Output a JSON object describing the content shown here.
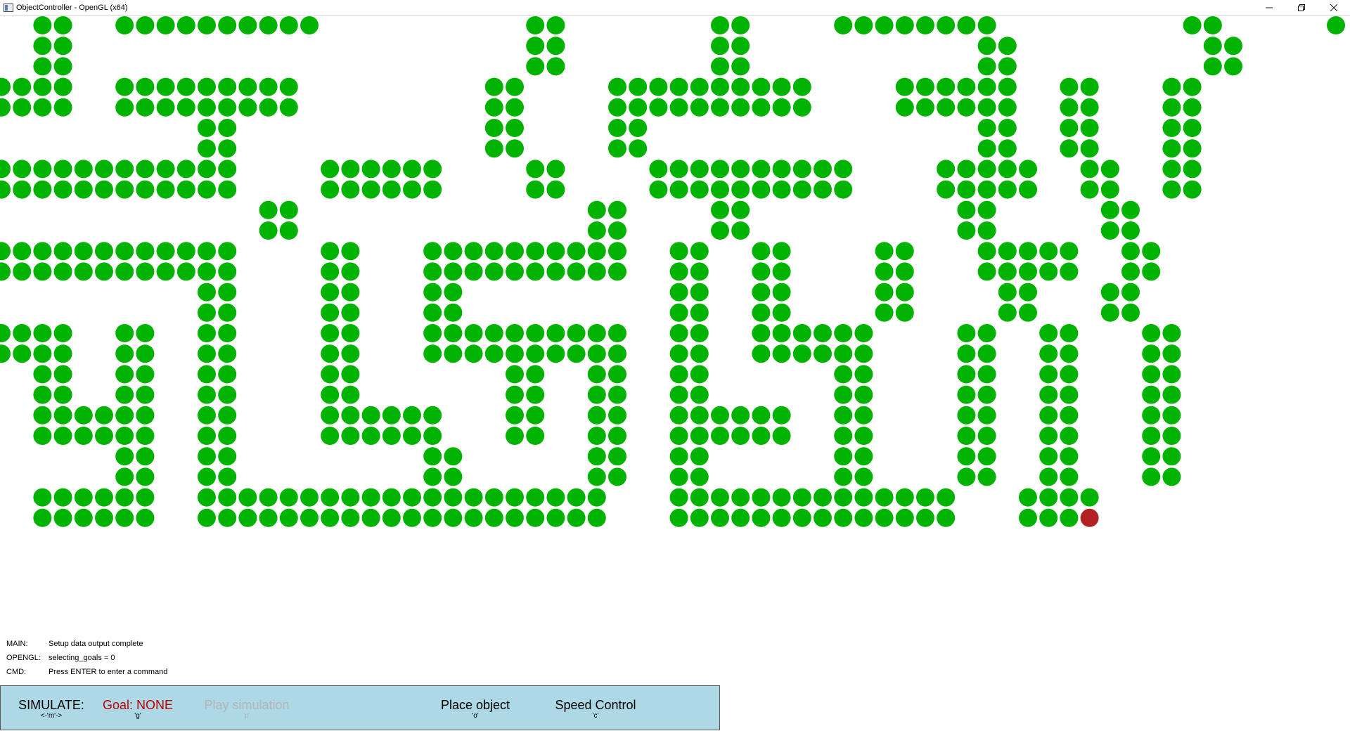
{
  "window": {
    "title": "ObjectController - OpenGL (x64)",
    "controls": [
      "minimize-icon",
      "restore-icon",
      "close-icon"
    ]
  },
  "maze": {
    "wall_color": "#00b300",
    "agent_color": "#b22222",
    "rows": [
      "..xx..xxxxxxxxxx..........xx.......xx....xxxxxxxx.........xx.....xxxxx.......",
      "..xx......................xx.......xx...........xx.........xx......xx...xx...",
      "..xx......................xx.......xx...........xx.........xx......xx...xx...",
      "xxxx..xxxxxxxxx.........xx....xxxxxxxxxx....xxxxxx..xx...xx.......xx.........",
      "xxxx..xxxxxxxxx.........xx....xxxxxxxxxx....xxxxxx..xx...xx.......xx.........",
      "..........xx............xx....xx................xx..xx...xx.......xx.........",
      "..........xx............xx....xx................xx..xx...xx.......xx.........",
      "xxxxxxxxxxxx....xxxxxx....xx....xxxxxxxxxx....xxxxx..xx..xx.......xx.........",
      "xxxxxxxxxxxx....xxxxxx....xx....xxxxxxxxxx....xxxxx..xx..xx.......xx.........",
      ".............xx..............xx....xx..........xx.....xx.....................",
      ".............xx..............xx....xx..........xx.....xx.....................",
      "xxxxxxxxxxxx....xx...xxxxxxxxxx..xx..xx....xx...xxxxx..xx....................",
      "xxxxxxxxxxxx....xx...xxxxxxxxxx..xx..xx....xx...xxxxx..xx....................",
      "..........xx....xx...xx..........xx..xx....xx....xx...xx......................",
      "..........xx....xx...xx..........xx..xx....xx....xx...xx......................",
      "xxxx..xx..xx....xx...xxxxxxxxxx..xx..xxxxxx....xx..xx...xx.....................",
      "xxxx..xx..xx....xx...xxxxxxxxxx..xx..xxxxxx....xx..xx...xx.....................",
      "..xx..xx..xx....xx.......xx..xx..xx......xx....xx..xx...xx.....................",
      "..xx..xx..xx....xx.......xx..xx..xx......xx....xx..xx...xx.....................",
      "..xxxxxx..xx....xxxxxx...xx..xx..xxxxxx..xx....xx..xx...xx.....................",
      "..xxxxxx..xx....xxxxxx...xx..xx..xxxxxx..xx....xx..xx...xx.....................",
      "......xx..xx.........xx......xx..xx......xx....xx..xx...xx.....................",
      "......xx..xx.........xx......xx..xx......xx....xx..xx...xx.....................",
      "..xxxxxx..xxxxxxxxxxxxxxxxxxxx...xxxxxxxxxxxxxx...xxxx.........................",
      "..xxxxxx..xxxxxxxxxxxxxxxxxxxx...xxxxxxxxxxxxxx...xxxA........................."
    ]
  },
  "log": [
    {
      "tag": "MAIN:",
      "msg": "Setup data output complete"
    },
    {
      "tag": "OPENGL:",
      "msg": "selecting_goals = 0"
    },
    {
      "tag": "CMD:",
      "msg": "Press ENTER to enter a command"
    }
  ],
  "commandbar": {
    "simulate": {
      "label": "SIMULATE:",
      "key": "<-'m'->"
    },
    "goal": {
      "label": "Goal: NONE",
      "key": "'g'",
      "color": "#c00000"
    },
    "play": {
      "label": "Play simulation",
      "key": "'p'",
      "color": "#b4b4b4"
    },
    "place": {
      "label": "Place object",
      "key": "'o'"
    },
    "speed": {
      "label": "Speed Control",
      "key": "'c'"
    }
  }
}
